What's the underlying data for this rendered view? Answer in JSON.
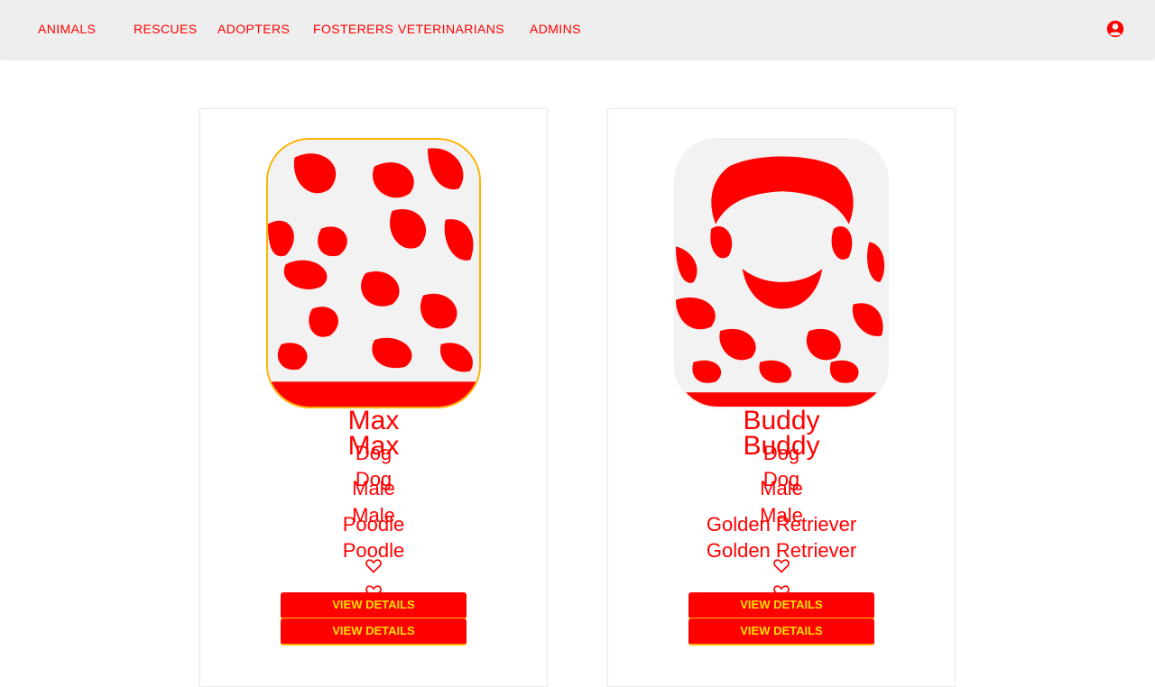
{
  "nav": {
    "links": [
      {
        "label": "Animals"
      },
      {
        "label": "Rescues"
      },
      {
        "label": "Adopters"
      },
      {
        "label": "Fosterers"
      },
      {
        "label": "Veterinarians"
      },
      {
        "label": "Admins"
      }
    ]
  },
  "icons": {
    "account": "account-circle-icon",
    "favorite": "heart-outline-icon"
  },
  "colors": {
    "accent": "#ff0000",
    "highlight": "#ffb300",
    "topbar": "#eeeeee"
  },
  "animals": [
    {
      "name": "Max",
      "species": "Dog",
      "gender": "Male",
      "breed": "Poodle",
      "button": "View Details"
    },
    {
      "name": "Buddy",
      "species": "Dog",
      "gender": "Male",
      "breed": "Golden Retriever",
      "button": "View Details"
    }
  ]
}
